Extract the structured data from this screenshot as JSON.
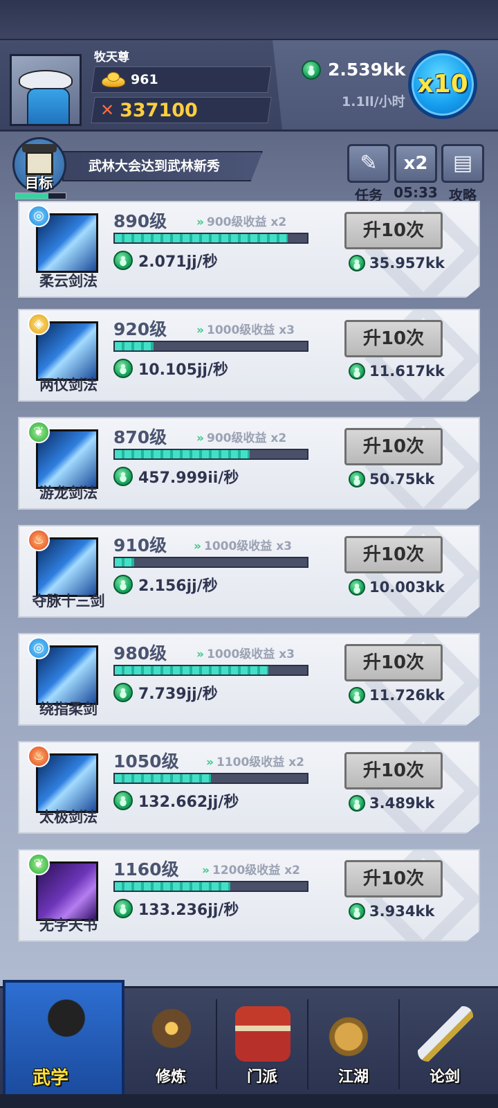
{
  "player": {
    "name": "牧天尊",
    "gold": "961",
    "power": "337100"
  },
  "income": {
    "total": "2.539kk",
    "rate": "1.1ll/小时",
    "multiplier_label": "x10"
  },
  "goal": {
    "badge_label": "目标",
    "text": "武林大会达到武林新秀",
    "progress": 0.65
  },
  "top_actions": [
    {
      "label": "任务",
      "icon": "scroll-icon"
    },
    {
      "label": "05:33",
      "icon": "x2-boost-icon",
      "button_text": "x2"
    },
    {
      "label": "攻略",
      "icon": "guide-book-icon"
    }
  ],
  "upgrade_label": "升10次",
  "skills": [
    {
      "name": "柔云剑法",
      "level": "890级",
      "bonus": "900级收益 x2",
      "progress": 0.9,
      "rate": "2.071jj/秒",
      "cost": "35.957kk",
      "element": "water"
    },
    {
      "name": "两仪剑法",
      "level": "920级",
      "bonus": "1000级收益 x3",
      "progress": 0.2,
      "rate": "10.105jj/秒",
      "cost": "11.617kk",
      "element": "earth"
    },
    {
      "name": "游龙剑法",
      "level": "870级",
      "bonus": "900级收益 x2",
      "progress": 0.7,
      "rate": "457.999ii/秒",
      "cost": "50.75kk",
      "element": "wood"
    },
    {
      "name": "夺脉十三剑",
      "level": "910级",
      "bonus": "1000级收益 x3",
      "progress": 0.1,
      "rate": "2.156jj/秒",
      "cost": "10.003kk",
      "element": "fire"
    },
    {
      "name": "绕指柔剑",
      "level": "980级",
      "bonus": "1000级收益 x3",
      "progress": 0.8,
      "rate": "7.739jj/秒",
      "cost": "11.726kk",
      "element": "water"
    },
    {
      "name": "太极剑法",
      "level": "1050级",
      "bonus": "1100级收益 x2",
      "progress": 0.5,
      "rate": "132.662jj/秒",
      "cost": "3.489kk",
      "element": "fire"
    },
    {
      "name": "无字天书",
      "level": "1160级",
      "bonus": "1200级收益 x2",
      "progress": 0.6,
      "rate": "133.236jj/秒",
      "cost": "3.934kk",
      "element": "wood"
    }
  ],
  "nav": [
    {
      "label": "武学",
      "active": true
    },
    {
      "label": "修炼",
      "active": false
    },
    {
      "label": "门派",
      "active": false
    },
    {
      "label": "江湖",
      "active": false
    },
    {
      "label": "论剑",
      "active": false
    }
  ]
}
